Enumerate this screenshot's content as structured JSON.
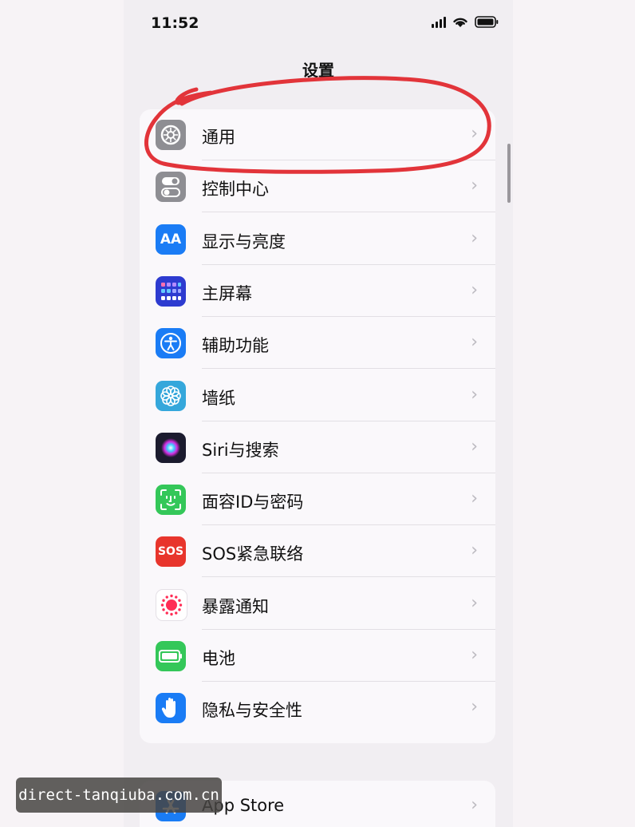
{
  "status": {
    "time": "11:52"
  },
  "nav": {
    "title": "设置"
  },
  "settings": [
    {
      "label": "通用",
      "icon": "gear-icon",
      "color": "#8e8e93"
    },
    {
      "label": "控制中心",
      "icon": "toggle-icon",
      "color": "#8e8e93"
    },
    {
      "label": "显示与亮度",
      "icon": "text-size-icon",
      "icon_text": "AA",
      "color": "#1a7cf5"
    },
    {
      "label": "主屏幕",
      "icon": "home-grid-icon",
      "color": "#2d3bd0"
    },
    {
      "label": "辅助功能",
      "icon": "accessibility-icon",
      "color": "#1a7cf5"
    },
    {
      "label": "墙纸",
      "icon": "flower-icon",
      "color": "#35a7db"
    },
    {
      "label": "Siri与搜索",
      "icon": "siri-icon",
      "color": "#1b1b2e"
    },
    {
      "label": "面容ID与密码",
      "icon": "face-id-icon",
      "color": "#34c759"
    },
    {
      "label": "SOS紧急联络",
      "icon": "sos-icon",
      "icon_text": "SOS",
      "color": "#e8352c"
    },
    {
      "label": "暴露通知",
      "icon": "exposure-icon",
      "color": "#ffffff"
    },
    {
      "label": "电池",
      "icon": "battery-setting-icon",
      "color": "#34c759"
    },
    {
      "label": "隐私与安全性",
      "icon": "hand-icon",
      "color": "#1a7cf5"
    }
  ],
  "second_group": [
    {
      "label": "App Store",
      "icon": "app-store-icon",
      "color": "#1a7cf5"
    }
  ],
  "chevron": "›",
  "annotation": {
    "color": "#e2343a"
  },
  "watermark": {
    "text": "direct-tanqiuba.com.cn"
  }
}
